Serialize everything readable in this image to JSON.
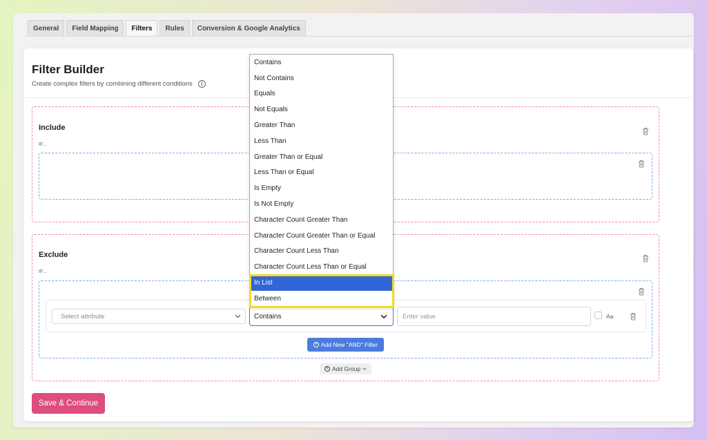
{
  "tabs": [
    {
      "label": "General",
      "active": false
    },
    {
      "label": "Field Mapping",
      "active": false
    },
    {
      "label": "Filters",
      "active": true
    },
    {
      "label": "Rules",
      "active": false
    },
    {
      "label": "Conversion & Google Analytics",
      "active": false
    }
  ],
  "header": {
    "title": "Filter Builder",
    "subtitle": "Create complex filters by combining different conditions",
    "info_icon": "info-icon"
  },
  "include_group": {
    "label": "Include",
    "if_label": "IF..."
  },
  "exclude_group": {
    "label": "Exclude",
    "if_label": "IF..."
  },
  "filter_row": {
    "attribute_placeholder": "Select attribute",
    "operator_value": "Contains",
    "value_placeholder": "Enter value",
    "case_label": "Aa"
  },
  "operator_options": [
    "Contains",
    "Not Contains",
    "Equals",
    "Not Equals",
    "Greater Than",
    "Less Than",
    "Greater Than or Equal",
    "Less Than or Equal",
    "Is Empty",
    "Is Not Empty",
    "Character Count Greater Than",
    "Character Count Greater Than or Equal",
    "Character Count Less Than",
    "Character Count Less Than or Equal",
    "In List",
    "Between"
  ],
  "selected_option_index": 14,
  "buttons": {
    "add_and_filter": "Add New \"AND\" Filter",
    "add_group": "Add Group",
    "save_continue": "Save & Continue"
  },
  "colors": {
    "accent_blue": "#4c7bdc",
    "selected_blue": "#3266d6",
    "save_pink": "#dd4d7f",
    "highlight_yellow": "#f3dc1c",
    "include_border": "#e98ab0",
    "inner_border": "#7aa8e6"
  }
}
